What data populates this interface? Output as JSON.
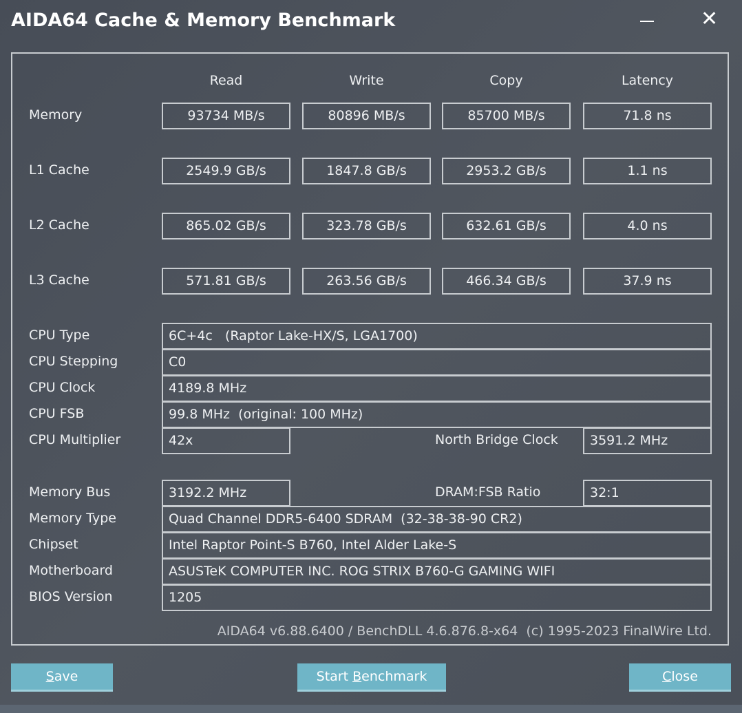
{
  "window": {
    "title": "AIDA64 Cache & Memory Benchmark"
  },
  "columns": [
    "Read",
    "Write",
    "Copy",
    "Latency"
  ],
  "rows": [
    {
      "label": "Memory",
      "values": [
        "93734 MB/s",
        "80896 MB/s",
        "85700 MB/s",
        "71.8 ns"
      ]
    },
    {
      "label": "L1 Cache",
      "values": [
        "2549.9 GB/s",
        "1847.8 GB/s",
        "2953.2 GB/s",
        "1.1 ns"
      ]
    },
    {
      "label": "L2 Cache",
      "values": [
        "865.02 GB/s",
        "323.78 GB/s",
        "632.61 GB/s",
        "4.0 ns"
      ]
    },
    {
      "label": "L3 Cache",
      "values": [
        "571.81 GB/s",
        "263.56 GB/s",
        "466.34 GB/s",
        "37.9 ns"
      ]
    }
  ],
  "info": {
    "cpu_type": {
      "label": "CPU Type",
      "value": "6C+4c   (Raptor Lake-HX/S, LGA1700)"
    },
    "cpu_stepping": {
      "label": "CPU Stepping",
      "value": "C0"
    },
    "cpu_clock": {
      "label": "CPU Clock",
      "value": "4189.8 MHz"
    },
    "cpu_fsb": {
      "label": "CPU FSB",
      "value": "99.8 MHz  (original: 100 MHz)"
    },
    "cpu_multiplier": {
      "label": "CPU Multiplier",
      "value": "42x"
    },
    "north_bridge_clock": {
      "label": "North Bridge Clock",
      "value": "3591.2 MHz"
    },
    "memory_bus": {
      "label": "Memory Bus",
      "value": "3192.2 MHz"
    },
    "dram_fsb_ratio": {
      "label": "DRAM:FSB Ratio",
      "value": "32:1"
    },
    "memory_type": {
      "label": "Memory Type",
      "value": "Quad Channel DDR5-6400 SDRAM  (32-38-38-90 CR2)"
    },
    "chipset": {
      "label": "Chipset",
      "value": "Intel Raptor Point-S B760, Intel Alder Lake-S"
    },
    "motherboard": {
      "label": "Motherboard",
      "value": "ASUSTeK COMPUTER INC. ROG STRIX B760-G GAMING WIFI"
    },
    "bios_version": {
      "label": "BIOS Version",
      "value": "1205"
    }
  },
  "footer": "AIDA64 v6.88.6400 / BenchDLL 4.6.876.8-x64  (c) 1995-2023 FinalWire Ltd.",
  "buttons": {
    "save": {
      "first": "S",
      "rest": "ave"
    },
    "start": {
      "pre": "Start ",
      "first": "B",
      "rest": "enchmark"
    },
    "close": {
      "first": "C",
      "rest": "lose"
    }
  }
}
